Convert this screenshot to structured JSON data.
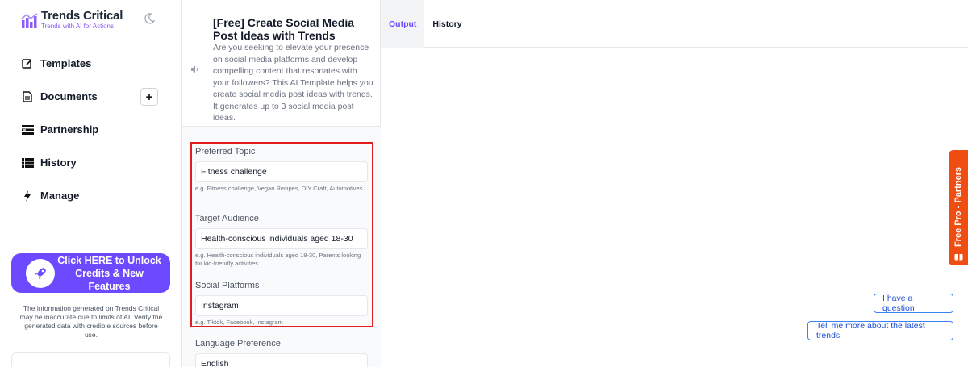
{
  "brand": {
    "name": "Trends Critical",
    "tagline": "Trends with AI for Actions",
    "accent": "#8b5cf6"
  },
  "sidebar": {
    "items": [
      {
        "label": "Templates",
        "icon": "edit-icon"
      },
      {
        "label": "Documents",
        "icon": "document-icon"
      },
      {
        "label": "Partnership",
        "icon": "partnership-icon"
      },
      {
        "label": "History",
        "icon": "list-icon"
      },
      {
        "label": "Manage",
        "icon": "bolt-icon"
      }
    ],
    "add_label": "+",
    "promo": {
      "label": "Click HERE to Unlock Credits & New Features",
      "color": "#6d4aff"
    },
    "disclaimer": "The information generated on Trends Critical may be inaccurate due to limits of AI. Verify the generated data with credible sources before use."
  },
  "template": {
    "title": "[Free] Create Social Media Post Ideas with Trends",
    "description": "Are you seeking to elevate your presence on social media platforms and develop compelling content that resonates with your followers? This AI Template helps you create social media post ideas with trends. It generates up to 3 social media post ideas."
  },
  "form": {
    "fields": [
      {
        "label": "Preferred Topic",
        "value": "Fitness challenge",
        "hint": "e.g. Fitness challenge, Vegan Recipes, DIY Craft, Automotives"
      },
      {
        "label": "Target Audience",
        "value": "Health-conscious individuals aged 18-30",
        "hint": "e.g. Health-conscious individuals aged 18-30, Parents looking for kid-friendly activities"
      },
      {
        "label": "Social Platforms",
        "value": "Instagram",
        "hint": "e.g. Tiktok, Facebook, Instagram"
      },
      {
        "label": "Language Preference",
        "value": "English",
        "hint": ""
      }
    ],
    "highlight_color": "#e11d1d"
  },
  "main": {
    "tabs": [
      {
        "label": "Output",
        "active": true
      },
      {
        "label": "History",
        "active": false
      }
    ],
    "partners_tab": {
      "label": "Free Pro - Partners",
      "color": "#f04d12"
    },
    "suggestions": [
      "I have a question",
      "Tell me more about the latest trends"
    ]
  }
}
